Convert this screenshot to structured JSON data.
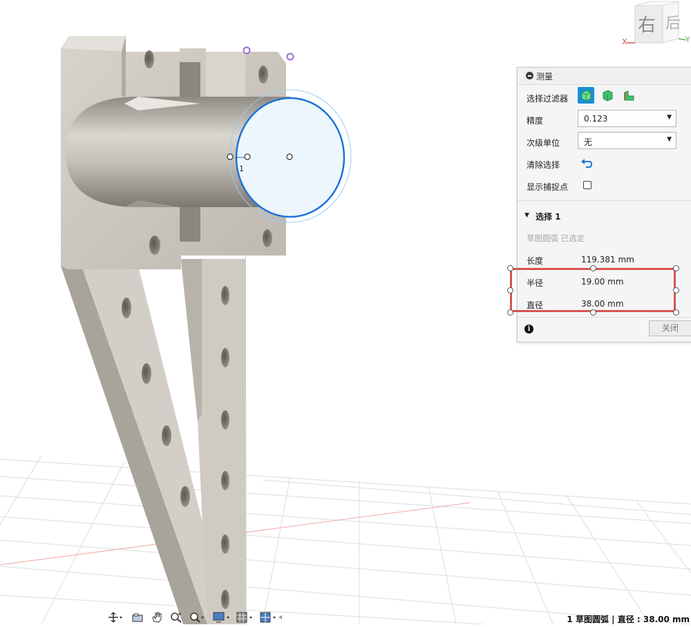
{
  "viewcube": {
    "face_right": "右",
    "face_back": "后",
    "axis_x": "X",
    "axis_y": "Y"
  },
  "sketch": {
    "point_label": "1"
  },
  "measure_panel": {
    "title": "测量",
    "filter_label": "选择过滤器",
    "precision_label": "精度",
    "precision_value": "0.123",
    "secondary_units_label": "次级单位",
    "secondary_units_value": "无",
    "clear_selection_label": "清除选择",
    "show_snap_points_label": "显示捕捉点",
    "show_snap_points_checked": false,
    "selection_header": "选择 1",
    "selection_type": "草图圆弧 已选定",
    "length_label": "长度",
    "length_value": "119.381 mm",
    "radius_label": "半径",
    "radius_value": "19.00 mm",
    "diameter_label": "直径",
    "diameter_value": "38.00 mm",
    "close_label": "关闭",
    "info_icon": "i"
  },
  "toolbar": {
    "items": [
      "orbit-icon",
      "look-at-icon",
      "pan-icon",
      "zoom-icon",
      "fit-icon",
      "display-settings-icon",
      "grid-settings-icon",
      "viewports-icon"
    ]
  },
  "status": {
    "text": "1 草图圆弧 | 直径 : 38.00 mm"
  },
  "colors": {
    "highlight": "#d9534f",
    "sketch_blue": "#1a73d9",
    "accent": "#1a8fd8",
    "model_gray": "#c9c4bb"
  }
}
